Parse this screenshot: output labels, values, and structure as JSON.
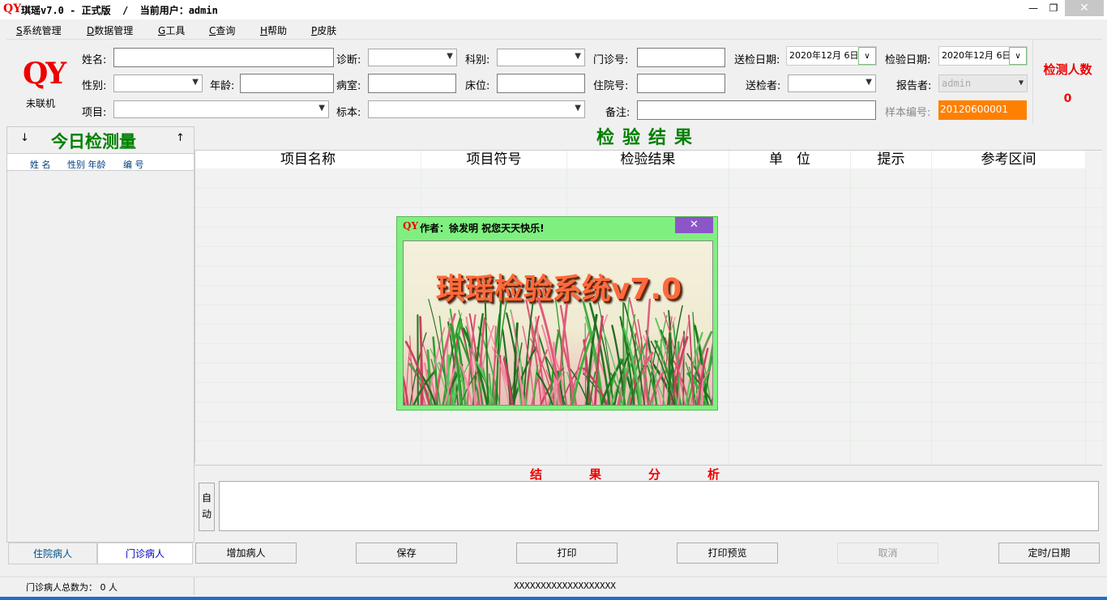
{
  "window": {
    "logo": "QY",
    "title": "琪瑶v7.0 - 正式版  /  当前用户：admin",
    "min_glyph": "—",
    "max_glyph": "❐",
    "close_glyph": "✕"
  },
  "menu": {
    "items": [
      {
        "key": "S",
        "label": "系统管理"
      },
      {
        "key": "D",
        "label": "数据管理"
      },
      {
        "key": "G",
        "label": "工具"
      },
      {
        "key": "C",
        "label": "查询"
      },
      {
        "key": "H",
        "label": "帮助"
      },
      {
        "key": "P",
        "label": "皮肤"
      }
    ]
  },
  "brand": {
    "logo": "QY",
    "status": "未联机"
  },
  "form": {
    "name_label": "姓名:",
    "gender_label": "性别:",
    "age_label": "年龄:",
    "item_label": "项目:",
    "diagnosis_label": "诊断:",
    "ward_label": "病室:",
    "specimen_label": "标本:",
    "dept_label": "科别:",
    "bed_label": "床位:",
    "outpatient_label": "门诊号:",
    "inpatient_label": "住院号:",
    "note_label": "备注:",
    "send_date_label": "送检日期:",
    "send_date_value": "2020年12月 6日",
    "sender_label": "送检者:",
    "test_date_label": "检验日期:",
    "test_date_value": "2020年12月 6日",
    "reporter_label": "报告者:",
    "reporter_value": "admin",
    "sample_label": "样本编号:",
    "sample_value": "20120600001"
  },
  "count": {
    "title": "检测人数",
    "value": "0"
  },
  "left_panel": {
    "title": "今日检测量",
    "down_arrow": "↓",
    "up_arrow": "↑",
    "col_name": "姓  名",
    "col_gender_age": "性别 年龄",
    "col_number": "编  号",
    "tab_inpatient": "住院病人",
    "tab_outpatient": "门诊病人"
  },
  "results": {
    "title": "检验结果",
    "columns": [
      "项目名称",
      "项目符号",
      "检验结果",
      "单　位",
      "提示",
      "参考区间"
    ]
  },
  "analysis": {
    "title": "结果分析",
    "auto_button": "自动"
  },
  "buttons": {
    "add": "增加病人",
    "save": "保存",
    "print": "打印",
    "preview": "打印预览",
    "cancel": "取消",
    "timer": "定时/日期"
  },
  "status": {
    "left": "门诊病人总数为： 0 人",
    "middle": "XXXXXXXXXXXXXXXXXXX"
  },
  "dialog": {
    "logo": "QY",
    "title": "作者：徐发明 祝您天天快乐!",
    "close_glyph": "✕",
    "banner_text": "琪瑶检验系统v7.0"
  },
  "colors": {
    "accent_green": "#008000",
    "alert_red": "#ee0000",
    "sample_orange": "#ff8000",
    "dialog_green": "#7ff07f"
  }
}
